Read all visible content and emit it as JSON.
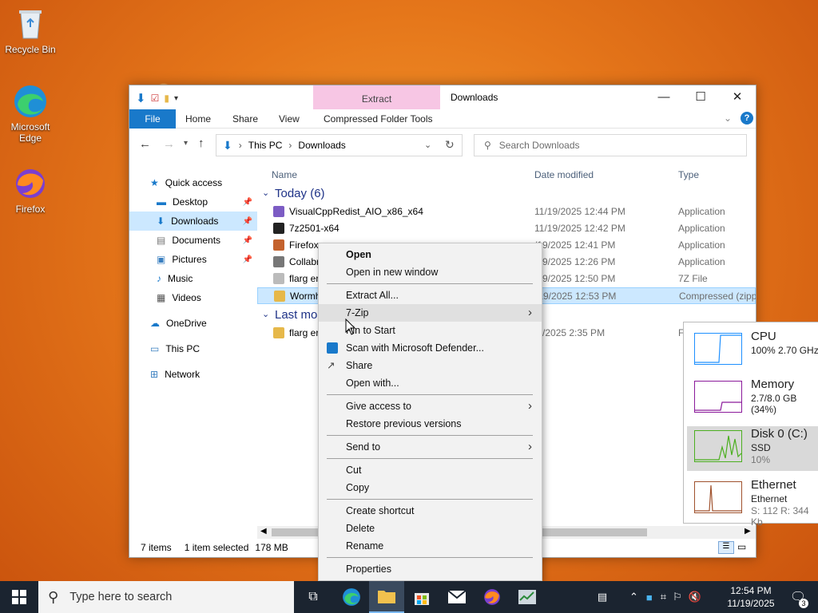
{
  "desktop_icons": [
    {
      "label": "Recycle Bin"
    },
    {
      "label": "Microsoft Edge"
    },
    {
      "label": "Firefox"
    }
  ],
  "explorer": {
    "title": "Downloads",
    "context_tab": "Extract",
    "ribbon_tabs": [
      "File",
      "Home",
      "Share",
      "View",
      "Compressed Folder Tools"
    ],
    "path": [
      "This PC",
      "Downloads"
    ],
    "search_placeholder": "Search Downloads",
    "nav": [
      {
        "label": "Quick access",
        "icon": "star-icon"
      },
      {
        "label": "Desktop",
        "icon": "desktop-folder-icon",
        "pinned": true
      },
      {
        "label": "Downloads",
        "icon": "download-folder-icon",
        "pinned": true,
        "selected": true
      },
      {
        "label": "Documents",
        "icon": "documents-icon",
        "pinned": true
      },
      {
        "label": "Pictures",
        "icon": "pictures-icon",
        "pinned": true
      },
      {
        "label": "Music",
        "icon": "music-icon"
      },
      {
        "label": "Videos",
        "icon": "videos-icon"
      },
      {
        "label": "OneDrive",
        "icon": "onedrive-icon"
      },
      {
        "label": "This PC",
        "icon": "pc-icon"
      },
      {
        "label": "Network",
        "icon": "network-icon"
      }
    ],
    "columns": {
      "name": "Name",
      "date": "Date modified",
      "type": "Type"
    },
    "group_today": "Today (6)",
    "group_last": "Last mo",
    "files_today": [
      {
        "name": "VisualCppRedist_AIO_x86_x64",
        "date": "11/19/2025 12:44 PM",
        "type": "Application"
      },
      {
        "name": "7z2501-x64",
        "date": "11/19/2025 12:42 PM",
        "type": "Application"
      },
      {
        "name": "Firefox",
        "date": "/19/2025 12:41 PM",
        "type": "Application"
      },
      {
        "name": "Collabr",
        "date": "/19/2025 12:26 PM",
        "type": "Application"
      },
      {
        "name": "flarg er",
        "date": "/19/2025 12:50 PM",
        "type": "7Z File"
      },
      {
        "name": "Wormh",
        "date": "/19/2025 12:53 PM",
        "type": "Compressed (zipp",
        "selected": true
      }
    ],
    "files_last": [
      {
        "name": "flarg er",
        "date": "/2/2025 2:35 PM",
        "type": "F"
      }
    ],
    "status": {
      "count": "7 items",
      "selected": "1 item selected",
      "size": "178 MB"
    }
  },
  "context_menu": {
    "items": [
      {
        "label": "Open",
        "bold": true
      },
      {
        "label": "Open in new window"
      },
      {
        "sep": true
      },
      {
        "label": "Extract All..."
      },
      {
        "label": "7-Zip",
        "submenu": true,
        "highlighted": true
      },
      {
        "label": "Pin to Start"
      },
      {
        "label": "Scan with Microsoft Defender...",
        "icon": "defender-icon"
      },
      {
        "label": "Share",
        "icon": "share-icon"
      },
      {
        "label": "Open with..."
      },
      {
        "sep": true
      },
      {
        "label": "Give access to",
        "submenu": true
      },
      {
        "label": "Restore previous versions"
      },
      {
        "sep": true
      },
      {
        "label": "Send to",
        "submenu": true
      },
      {
        "sep": true
      },
      {
        "label": "Cut"
      },
      {
        "label": "Copy"
      },
      {
        "sep": true
      },
      {
        "label": "Create shortcut"
      },
      {
        "label": "Delete"
      },
      {
        "label": "Rename"
      },
      {
        "sep": true
      },
      {
        "label": "Properties"
      }
    ]
  },
  "performance": [
    {
      "name": "CPU",
      "line1": "100%  2.70 GHz",
      "line2": "",
      "color": "#1e90ff"
    },
    {
      "name": "Memory",
      "line1": "2.7/8.0 GB (34%)",
      "line2": "",
      "color": "#8b1a9b"
    },
    {
      "name": "Disk 0 (C:)",
      "line1": "SSD",
      "line2": "10%",
      "color": "#4caf20",
      "selected": true
    },
    {
      "name": "Ethernet",
      "line1": "Ethernet",
      "line2": "S: 112  R: 344 Kb",
      "color": "#a0522d"
    }
  ],
  "taskbar": {
    "search_placeholder": "Type here to search",
    "time": "12:54 PM",
    "date": "11/19/2025",
    "notifications": "3"
  }
}
